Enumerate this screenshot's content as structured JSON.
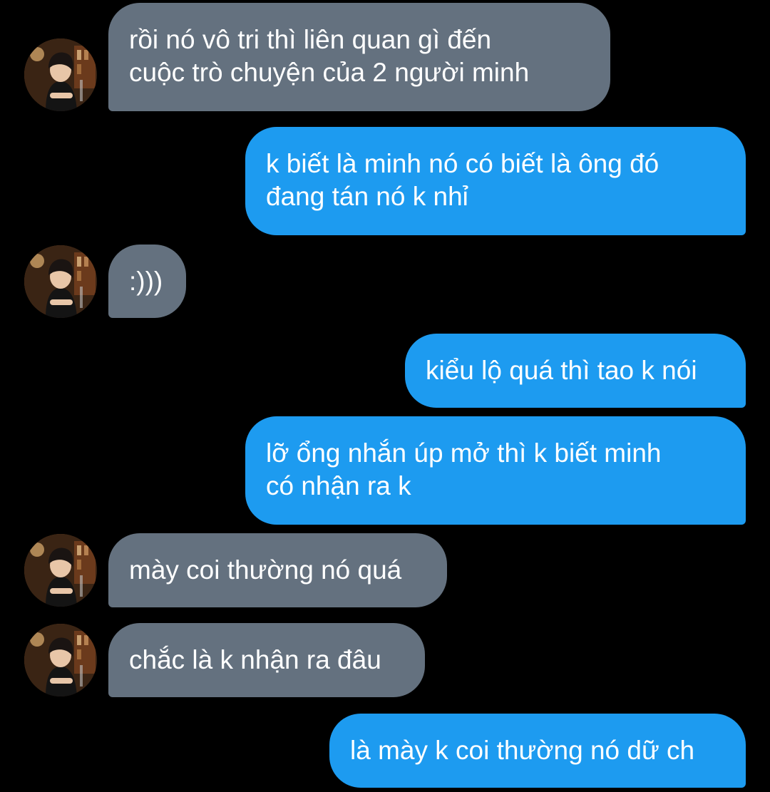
{
  "conversation": {
    "messages": [
      {
        "direction": "incoming",
        "lines": [
          "rồi nó vô tri thì liên quan gì đến",
          "cuộc trò chuyện của 2 người minh"
        ]
      },
      {
        "direction": "outgoing",
        "lines": [
          "k biết là minh nó có biết là ông đó",
          "đang tán nó k nhỉ"
        ]
      },
      {
        "direction": "incoming",
        "lines": [
          ":)))"
        ]
      },
      {
        "direction": "outgoing",
        "lines": [
          "kiểu lộ quá thì tao k nói"
        ]
      },
      {
        "direction": "outgoing",
        "lines": [
          "lỡ ổng nhắn úp mở thì k biết minh",
          "có nhận ra k"
        ]
      },
      {
        "direction": "incoming",
        "lines": [
          "mày coi thường nó quá"
        ]
      },
      {
        "direction": "incoming",
        "lines": [
          "chắc là k nhận ra đâu"
        ]
      },
      {
        "direction": "outgoing",
        "lines": [
          "là mày k coi thường nó dữ ch"
        ]
      }
    ]
  },
  "colors": {
    "background": "#000000",
    "incoming_bubble": "#64717f",
    "outgoing_bubble": "#1d9bf0",
    "text": "#ffffff"
  },
  "icons": {
    "avatar": "contact-avatar-photo"
  }
}
